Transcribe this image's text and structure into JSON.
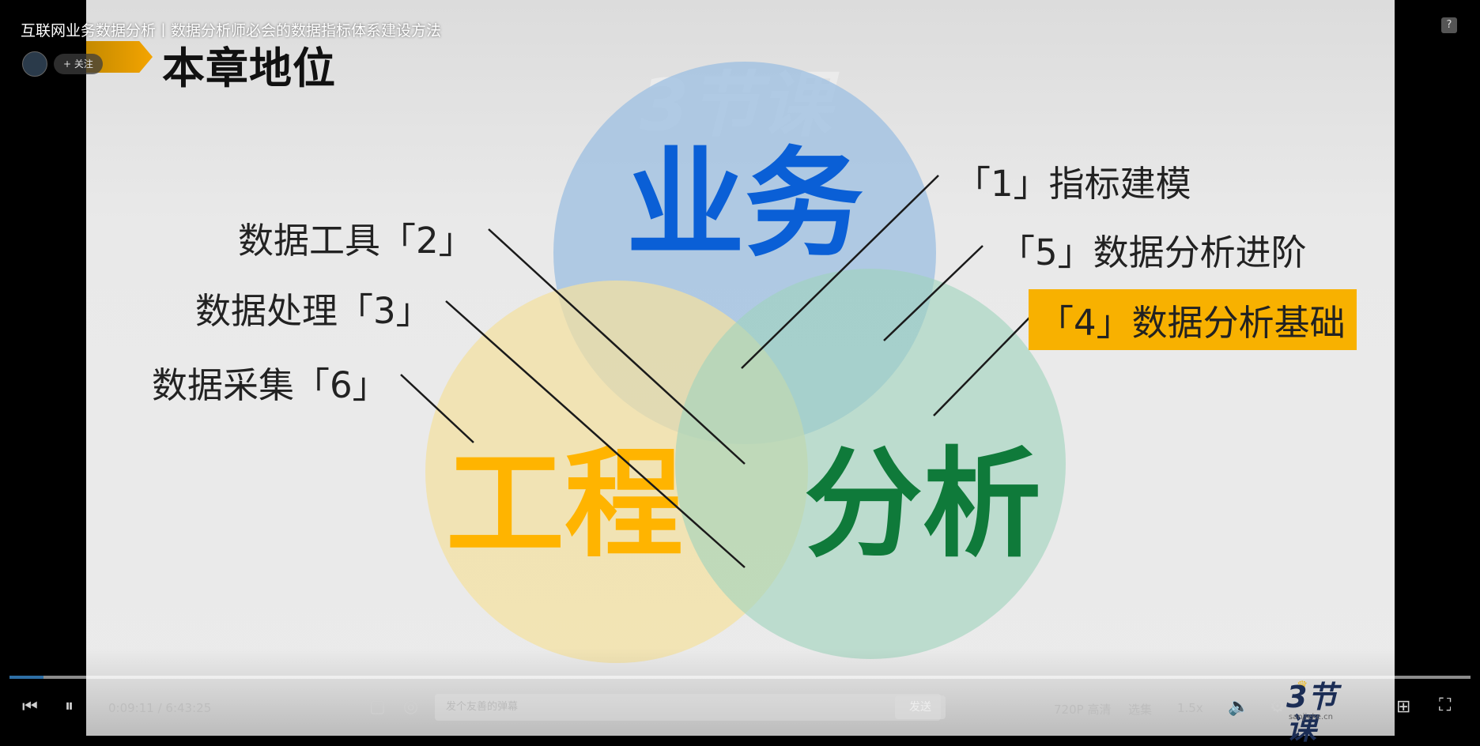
{
  "video": {
    "title": "互联网业务数据分析丨数据分析师必会的数据指标体系建设方法",
    "follow_label": "+ 关注"
  },
  "slide": {
    "chapter_title": "本章地位",
    "watermark": "3节课",
    "circles": {
      "business": {
        "label": "业务",
        "color": "#0a5fd6",
        "fill": "#9fc0e2"
      },
      "engineering": {
        "label": "工程",
        "color": "#ffb400",
        "fill": "#f4e0a0"
      },
      "analysis": {
        "label": "分析",
        "color": "#0f7a3a",
        "fill": "#9fd3bd"
      }
    },
    "labels": {
      "l1": "「1」指标建模",
      "l5": "「5」数据分析进阶",
      "l4": "「4」数据分析基础",
      "l2": "数据工具「2」",
      "l3": "数据处理「3」",
      "l6": "数据采集「6」"
    },
    "highlight_color": "#f8b100"
  },
  "player": {
    "time": "0:09:11 / 6:43:25",
    "progress": 0.023,
    "danmaku_placeholder": "发个友善的弹幕",
    "send_label": "发送",
    "quality": "720P 高清",
    "episodes": "选集",
    "speed": "1.5x",
    "logo_text": "3节课",
    "logo_domain": "sanjieke.cn",
    "accent": "#2e6fa5"
  }
}
